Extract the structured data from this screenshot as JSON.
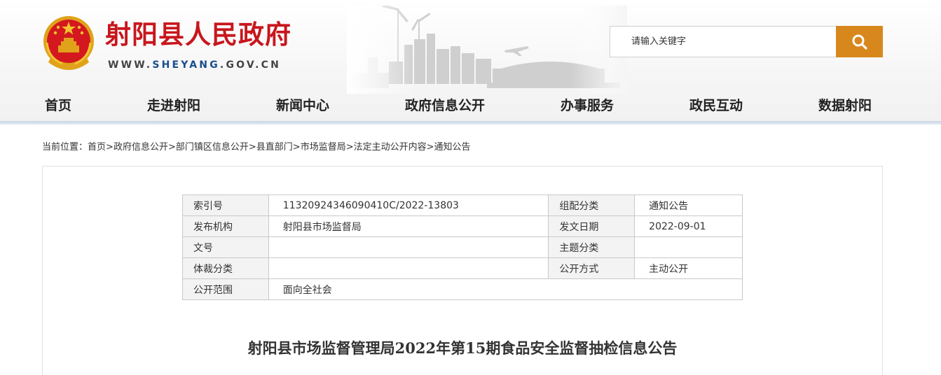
{
  "site": {
    "title": "射阳县人民政府",
    "url_prefix": "WWW.",
    "url_domain": "SHEYANG",
    "url_suffix": ".GOV.CN",
    "accent_color": "#c8161d"
  },
  "search": {
    "placeholder": "请输入关键字",
    "button_icon": "search-icon",
    "button_color": "#d8871d"
  },
  "nav": {
    "items": [
      {
        "label": "首页"
      },
      {
        "label": "走进射阳"
      },
      {
        "label": "新闻中心"
      },
      {
        "label": "政府信息公开"
      },
      {
        "label": "办事服务"
      },
      {
        "label": "政民互动"
      },
      {
        "label": "数据射阳"
      }
    ]
  },
  "breadcrumb": {
    "prefix": "当前位置：",
    "items": [
      {
        "label": "首页"
      },
      {
        "label": "政府信息公开"
      },
      {
        "label": "部门镇区信息公开"
      },
      {
        "label": "县直部门"
      },
      {
        "label": "市场监督局"
      },
      {
        "label": "法定主动公开内容"
      },
      {
        "label": "通知公告"
      }
    ],
    "separator": ">"
  },
  "meta": {
    "rows": [
      {
        "k1": "索引号",
        "v1": "11320924346090410C/2022-13803",
        "k2": "组配分类",
        "v2": "通知公告"
      },
      {
        "k1": "发布机构",
        "v1": "射阳县市场监督局",
        "k2": "发文日期",
        "v2": "2022-09-01"
      },
      {
        "k1": "文号",
        "v1": "",
        "k2": "主题分类",
        "v2": ""
      },
      {
        "k1": "体裁分类",
        "v1": "",
        "k2": "公开方式",
        "v2": "主动公开"
      },
      {
        "k1": "公开范围",
        "v1": "面向全社会"
      }
    ]
  },
  "article": {
    "title": "射阳县市场监督管理局2022年第15期食品安全监督抽检信息公告"
  }
}
